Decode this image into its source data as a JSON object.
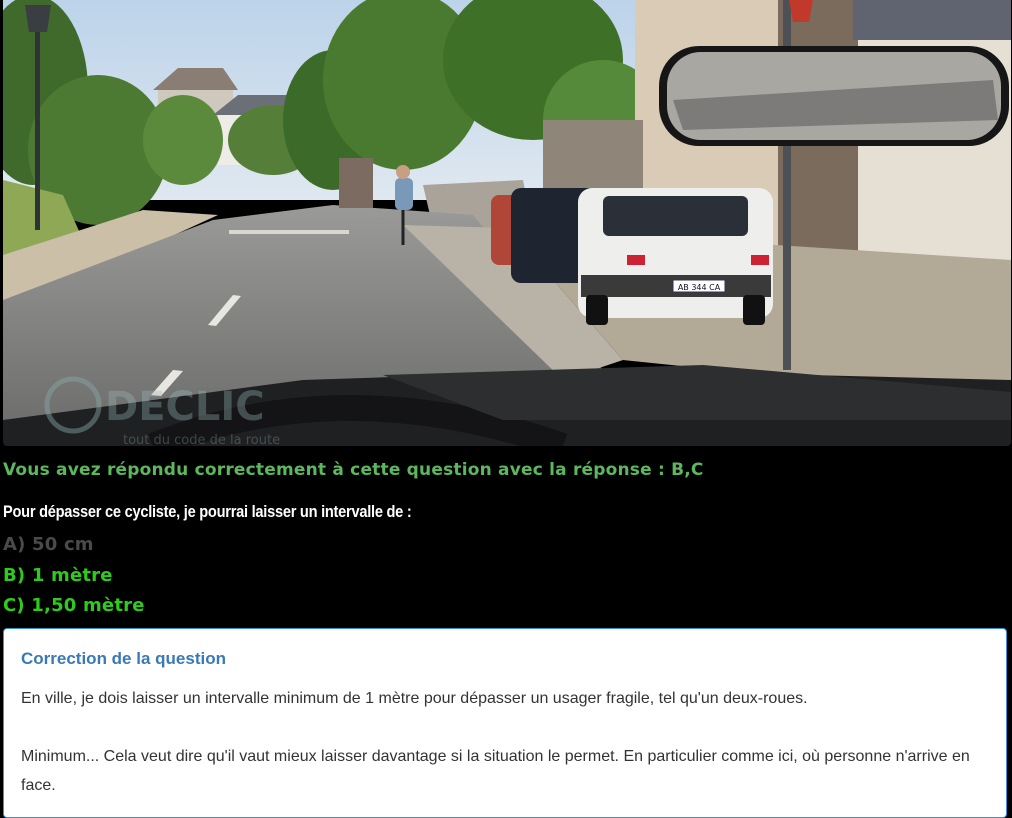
{
  "scene": {
    "watermark_text": "DECLIC",
    "watermark_subtext": "tout du code de la route",
    "plate_text": "AB 344 CA"
  },
  "result": {
    "text": "Vous avez répondu correctement à cette question avec la réponse : B,C"
  },
  "question": {
    "text": "Pour dépasser ce cycliste, je pourrai laisser un intervalle de :"
  },
  "answers": [
    {
      "label": "A) 50 cm",
      "status": "wrong"
    },
    {
      "label": "B) 1 mètre",
      "status": "correct"
    },
    {
      "label": "C) 1,50 mètre",
      "status": "correct"
    }
  ],
  "correction": {
    "title": "Correction de la question",
    "paragraphs": [
      "En ville, je dois laisser un intervalle minimum de 1 mètre pour dépasser un usager fragile, tel qu'un deux-roues.",
      "Minimum... Cela veut dire qu'il vaut mieux laisser davantage si la situation le permet. En particulier comme ici, où personne n'arrive en face."
    ]
  },
  "colors": {
    "background": "#000000",
    "result_green": "#5cb85c",
    "correct_green": "#2ecc1a",
    "wrong_gray": "#4a4a4a",
    "correction_title_blue": "#3a79b8",
    "correction_border": "#3a8fd8"
  }
}
